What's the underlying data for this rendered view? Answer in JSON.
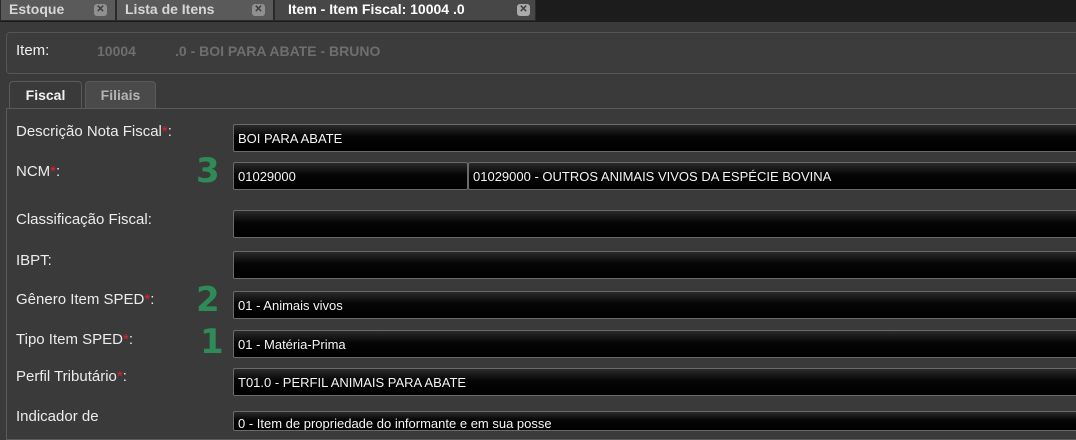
{
  "tabs": [
    {
      "label": "Estoque"
    },
    {
      "label": "Lista de Itens"
    },
    {
      "label": "Item - Item Fiscal: 10004 .0"
    }
  ],
  "item": {
    "label": "Item:",
    "code": "10004",
    "description": ".0 - BOI PARA ABATE - BRUNO"
  },
  "inner_tabs": [
    {
      "label": "Fiscal",
      "active": true
    },
    {
      "label": "Filiais",
      "active": false
    }
  ],
  "form": {
    "descricao": {
      "label": "Descrição Nota Fiscal",
      "required": "*",
      "colon": ":",
      "value": "BOI PARA ABATE"
    },
    "ncm": {
      "label": "NCM",
      "required": "*",
      "colon": ":",
      "code": "01029000",
      "description": "01029000 - OUTROS ANIMAIS VIVOS DA ESPÉCIE BOVINA"
    },
    "classificacao": {
      "label": "Classificação Fiscal:",
      "value": ""
    },
    "ibpt": {
      "label": "IBPT:",
      "value": ""
    },
    "genero": {
      "label": "Gênero Item SPED",
      "required": "*",
      "colon": ":",
      "value": "01 - Animais vivos"
    },
    "tipo": {
      "label": "Tipo Item SPED",
      "required": "*",
      "colon": ":",
      "value": "01 - Matéria-Prima"
    },
    "perfil": {
      "label": "Perfil Tributário",
      "required": "*",
      "colon": ":",
      "value": "T01.0 - PERFIL ANIMAIS PARA ABATE"
    },
    "indicador": {
      "label": "Indicador de",
      "value": "0 - Item de propriedade do informante e em sua posse"
    }
  },
  "annotations": {
    "ncm": "3",
    "genero": "2",
    "tipo": "1"
  },
  "colors": {
    "annotation": "#2e8b57",
    "required": "#e8202a",
    "background": "#3a3a3a"
  }
}
